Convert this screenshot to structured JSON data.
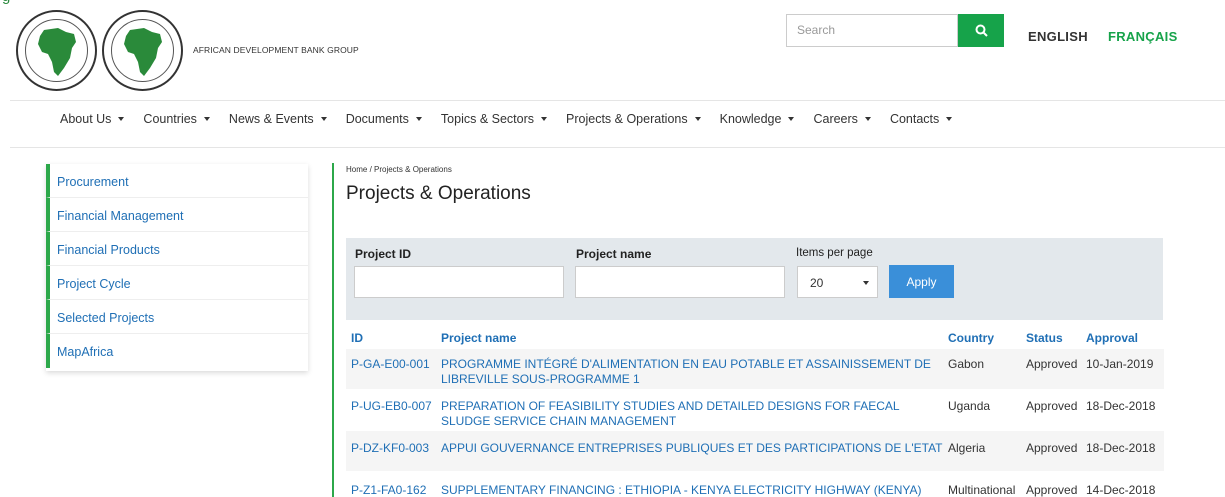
{
  "header": {
    "bank_name": "AFRICAN DEVELOPMENT BANK GROUP",
    "search_placeholder": "Search",
    "languages": [
      "ENGLISH",
      "FRANÇAIS"
    ],
    "accent": "#16a34a"
  },
  "nav": [
    "About Us",
    "Countries",
    "News & Events",
    "Documents",
    "Topics & Sectors",
    "Projects & Operations",
    "Knowledge",
    "Careers",
    "Contacts"
  ],
  "sidebar": [
    "Procurement",
    "Financial Management",
    "Financial Products",
    "Project Cycle",
    "Selected Projects",
    "MapAfrica"
  ],
  "breadcrumb": "Home / Projects & Operations",
  "page_title": "Projects & Operations",
  "filter": {
    "project_id_label": "Project ID",
    "project_name_label": "Project name",
    "items_label": "Items per page",
    "items_value": "20",
    "apply_label": "Apply"
  },
  "table": {
    "headers": [
      "ID",
      "Project name",
      "Country",
      "Status",
      "Approval"
    ],
    "rows": [
      {
        "id": "P-GA-E00-001",
        "name": "PROGRAMME INTÉGRÉ D'ALIMENTATION EN EAU POTABLE ET ASSAINISSEMENT DE LIBREVILLE SOUS-PROGRAMME 1",
        "country": "Gabon",
        "status": "Approved",
        "approval": "10-Jan-2019"
      },
      {
        "id": "P-UG-EB0-007",
        "name": "PREPARATION OF FEASIBILITY STUDIES AND DETAILED DESIGNS FOR FAECAL SLUDGE SERVICE CHAIN MANAGEMENT",
        "country": "Uganda",
        "status": "Approved",
        "approval": "18-Dec-2018"
      },
      {
        "id": "P-DZ-KF0-003",
        "name": "APPUI GOUVERNANCE ENTREPRISES PUBLIQUES ET DES PARTICIPATIONS DE L'ETAT",
        "country": "Algeria",
        "status": "Approved",
        "approval": "18-Dec-2018"
      },
      {
        "id": "P-Z1-FA0-162",
        "name": "SUPPLEMENTARY FINANCING : ETHIOPIA - KENYA ELECTRICITY HIGHWAY (KENYA)",
        "country": "Multinational",
        "status": "Approved",
        "approval": "14-Dec-2018"
      }
    ]
  }
}
